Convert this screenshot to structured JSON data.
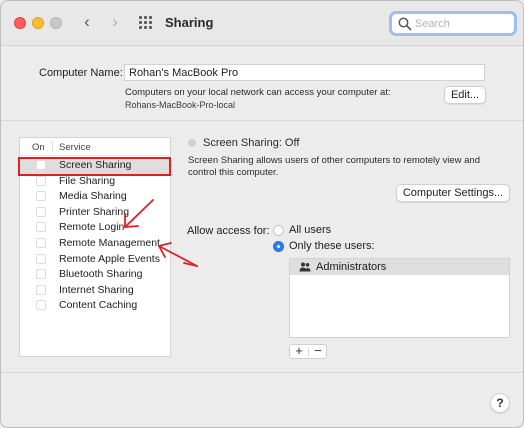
{
  "window": {
    "title": "Sharing",
    "search": {
      "placeholder": "Search",
      "value": ""
    }
  },
  "computer_name": {
    "label": "Computer Name:",
    "value": "Rohan's MacBook Pro",
    "description": "Computers on your local network can access your computer at:",
    "hostname": "Rohans-MacBook-Pro-local",
    "edit_label": "Edit..."
  },
  "services": {
    "col_on": "On",
    "col_service": "Service",
    "items": [
      {
        "label": "Screen Sharing",
        "checked": false,
        "selected": true
      },
      {
        "label": "File Sharing",
        "checked": false,
        "selected": false
      },
      {
        "label": "Media Sharing",
        "checked": false,
        "selected": false
      },
      {
        "label": "Printer Sharing",
        "checked": false,
        "selected": false
      },
      {
        "label": "Remote Login",
        "checked": false,
        "selected": false
      },
      {
        "label": "Remote Management",
        "checked": false,
        "selected": false
      },
      {
        "label": "Remote Apple Events",
        "checked": false,
        "selected": false
      },
      {
        "label": "Bluetooth Sharing",
        "checked": false,
        "selected": false
      },
      {
        "label": "Internet Sharing",
        "checked": false,
        "selected": false
      },
      {
        "label": "Content Caching",
        "checked": false,
        "selected": false
      }
    ]
  },
  "detail": {
    "status": "Screen Sharing: Off",
    "description": "Screen Sharing allows users of other computers to remotely view and control this computer.",
    "settings_button": "Computer Settings...",
    "allow_access_label": "Allow access for:",
    "option_all": "All users",
    "option_only": "Only these users:",
    "selected_option": "only",
    "users": [
      "Administrators"
    ],
    "add_label": "+",
    "remove_label": "−"
  },
  "help_label": "?",
  "colors": {
    "accent": "#2f7cf6",
    "annotation": "#e02020",
    "selection": "#dedede"
  }
}
